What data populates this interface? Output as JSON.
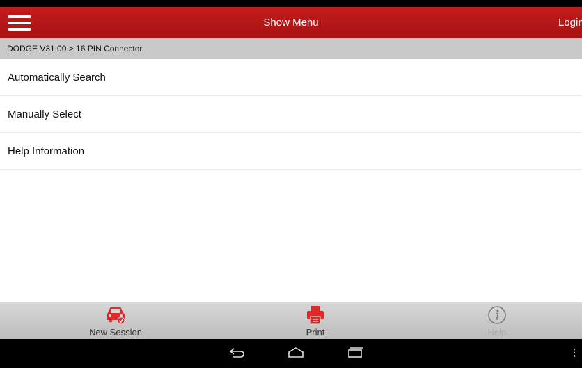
{
  "header": {
    "title": "Show Menu",
    "login_label": "Login",
    "menu_icon": "hamburger-icon",
    "color": "#b51717"
  },
  "breadcrumb": {
    "text": "DODGE V31.00 > 16 PIN Connector"
  },
  "menu_items": [
    {
      "label": "Automatically Search"
    },
    {
      "label": "Manually Select"
    },
    {
      "label": "Help Information"
    }
  ],
  "footer": {
    "buttons": [
      {
        "label": "New Session",
        "icon": "car-icon",
        "enabled": true
      },
      {
        "label": "Print",
        "icon": "printer-icon",
        "enabled": true
      },
      {
        "label": "Help",
        "icon": "info-icon",
        "enabled": false
      }
    ],
    "accent_color": "#e02a2a"
  },
  "system_nav": {
    "icons": [
      "back-icon",
      "home-icon",
      "recent-apps-icon",
      "overflow-menu-icon"
    ]
  }
}
